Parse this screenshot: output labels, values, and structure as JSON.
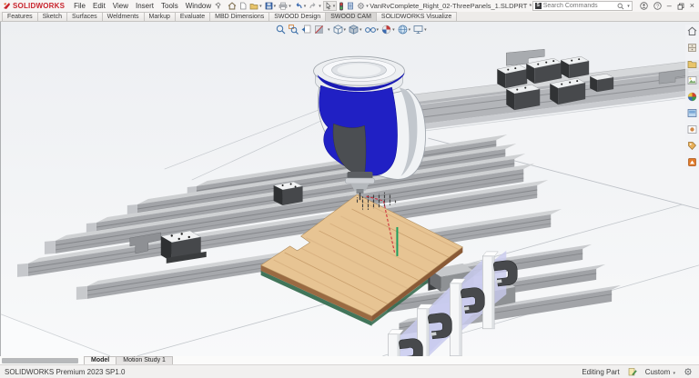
{
  "app": {
    "logo": "SOLIDWORKS",
    "document_title": "VanRvComplete_Right_02-ThreePanels_1.SLDPRT *",
    "menus": [
      "File",
      "Edit",
      "View",
      "Insert",
      "Tools",
      "Window"
    ],
    "search": {
      "placeholder": "Search Commands"
    },
    "window_controls": [
      "user",
      "help",
      "minimize",
      "restore",
      "close"
    ]
  },
  "quick_access_icons": [
    "home",
    "new-document",
    "open",
    "save",
    "print",
    "undo",
    "redo",
    "select",
    "rebuild",
    "file-properties",
    "options"
  ],
  "command_tabs": {
    "active": "SWOOD CAM",
    "items": [
      "Features",
      "Sketch",
      "Surfaces",
      "Weldments",
      "Markup",
      "Evaluate",
      "MBD Dimensions",
      "SWOOD Design",
      "SWOOD CAM",
      "SOLIDWORKS Visualize"
    ]
  },
  "heads_up_toolbar": [
    "zoom-to-fit",
    "zoom-to-area",
    "previous-view",
    "section-view",
    "view-orientation",
    "display-style",
    "hide-show-items",
    "edit-appearance",
    "apply-scene",
    "view-settings"
  ],
  "task_pane_icons": [
    "solidworks-resources",
    "design-library",
    "file-explorer",
    "view-palette",
    "appearances",
    "scenes",
    "decals",
    "custom-properties",
    "swood-library"
  ],
  "bottom_tabs": {
    "active": "Model",
    "items": [
      "Model",
      "Motion Study 1"
    ]
  },
  "status_bar": {
    "left": "SOLIDWORKS Premium 2023 SP1.0",
    "editing_state": "Editing Part",
    "unit_system": "Custom"
  },
  "scene": {
    "description": "CNC machining bed with aluminum rails, vacuum pods and pop-up clamps holding a wooden panel; CNC spindle head with blue cover and drill bit above a drilled hole pattern; red dashed rapid-move toolpath line",
    "colors": {
      "spindle_cover": "#2020c4",
      "wood_panel": "#e7c globalization",
      "wood": "#e7c493",
      "wood_edge": "#8a5a36",
      "rail_top": "#c9cbcd",
      "rail_front": "#9ea0a4",
      "clamp_dark": "#46484b",
      "pod_top": "#f1f2f3",
      "popup_web": "#c9cbee",
      "toolpath_red": "#cc2233",
      "highlight_green": "#1d9e5f"
    }
  }
}
